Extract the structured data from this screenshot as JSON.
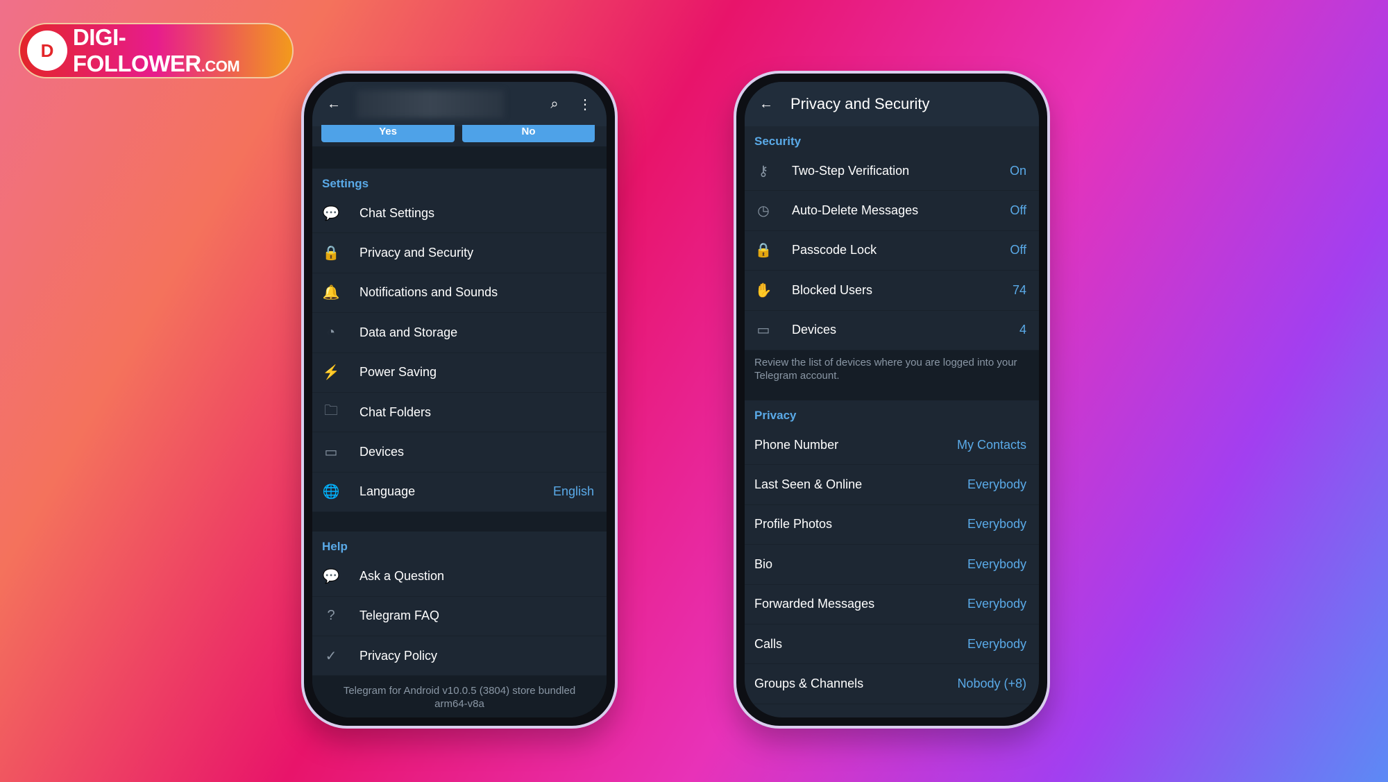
{
  "logo": {
    "badge": "D",
    "text": "DIGI-FOLLOWER",
    "suffix": ".COM"
  },
  "left": {
    "buttons": {
      "yes": "Yes",
      "no": "No"
    },
    "settings_header": "Settings",
    "settings": [
      {
        "label": "Chat Settings",
        "icon": "chat-icon",
        "glyph": "💬"
      },
      {
        "label": "Privacy and Security",
        "icon": "lock-icon",
        "glyph": "🔒"
      },
      {
        "label": "Notifications and Sounds",
        "icon": "bell-icon",
        "glyph": "🔔"
      },
      {
        "label": "Data and Storage",
        "icon": "pie-chart-icon",
        "glyph": "◔"
      },
      {
        "label": "Power Saving",
        "icon": "battery-icon",
        "glyph": "⚡"
      },
      {
        "label": "Chat Folders",
        "icon": "folder-icon",
        "glyph": "🗀"
      },
      {
        "label": "Devices",
        "icon": "devices-icon",
        "glyph": "▭"
      },
      {
        "label": "Language",
        "icon": "globe-icon",
        "glyph": "🌐",
        "value": "English"
      }
    ],
    "help_header": "Help",
    "help": [
      {
        "label": "Ask a Question",
        "icon": "chat-dots-icon",
        "glyph": "💬"
      },
      {
        "label": "Telegram FAQ",
        "icon": "question-icon",
        "glyph": "?"
      },
      {
        "label": "Privacy Policy",
        "icon": "shield-check-icon",
        "glyph": "✓"
      }
    ],
    "footer": [
      "Telegram for Android v10.0.5 (3804) store bundled",
      "arm64-v8a"
    ]
  },
  "right": {
    "title": "Privacy and Security",
    "security_header": "Security",
    "security": [
      {
        "label": "Two-Step Verification",
        "value": "On",
        "icon": "key-icon",
        "glyph": "⚷"
      },
      {
        "label": "Auto-Delete Messages",
        "value": "Off",
        "icon": "timer-icon",
        "glyph": "◷"
      },
      {
        "label": "Passcode Lock",
        "value": "Off",
        "icon": "lock-icon",
        "glyph": "🔒"
      },
      {
        "label": "Blocked Users",
        "value": "74",
        "icon": "hand-icon",
        "glyph": "✋"
      },
      {
        "label": "Devices",
        "value": "4",
        "icon": "devices-icon",
        "glyph": "▭"
      }
    ],
    "security_desc": "Review the list of devices where you are logged into your Telegram account.",
    "privacy_header": "Privacy",
    "privacy": [
      {
        "label": "Phone Number",
        "value": "My Contacts"
      },
      {
        "label": "Last Seen & Online",
        "value": "Everybody"
      },
      {
        "label": "Profile Photos",
        "value": "Everybody"
      },
      {
        "label": "Bio",
        "value": "Everybody"
      },
      {
        "label": "Forwarded Messages",
        "value": "Everybody"
      },
      {
        "label": "Calls",
        "value": "Everybody"
      },
      {
        "label": "Groups & Channels",
        "value": "Nobody (+8)"
      }
    ]
  },
  "colors": {
    "accent": "#5aaae8",
    "screen_bg": "#1d2733"
  }
}
